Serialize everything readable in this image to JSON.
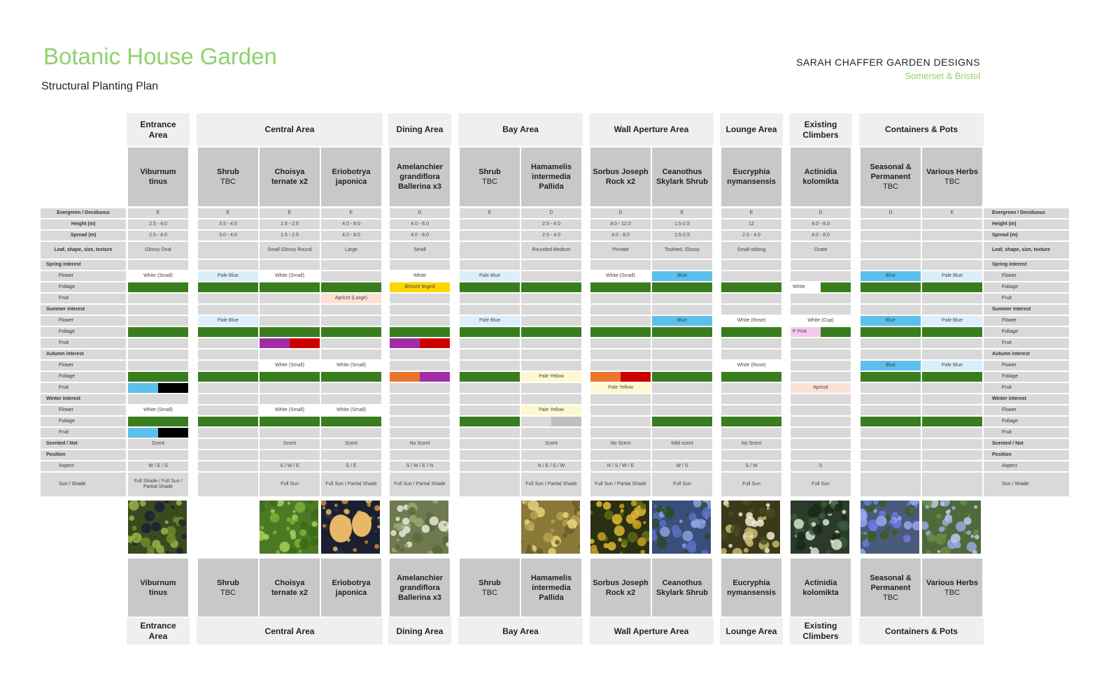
{
  "header": {
    "title": "Botanic House Garden",
    "subtitle": "Structural Planting Plan",
    "brand": "SARAH CHAFFER GARDEN DESIGNS",
    "brand_sub": "Somerset & Bristol"
  },
  "areas": [
    {
      "name": "Entrance Area",
      "name_html": "Entrance<br>Area",
      "cols": [
        0
      ]
    },
    {
      "name": "Central Area",
      "cols": [
        1,
        2,
        3
      ]
    },
    {
      "name": "Dining Area",
      "cols": [
        4
      ]
    },
    {
      "name": "Bay Area",
      "cols": [
        5,
        6
      ]
    },
    {
      "name": "Wall Aperture Area",
      "cols": [
        7,
        8
      ]
    },
    {
      "name": "Lounge Area",
      "cols": [
        9
      ]
    },
    {
      "name": "Existing Climbers",
      "name_html": "Existing<br>Climbers",
      "cols": [
        10
      ]
    },
    {
      "name": "Containers & Pots",
      "cols": [
        11,
        12
      ]
    }
  ],
  "plants": [
    {
      "lines": [
        "Viburnum",
        "tinus"
      ],
      "bold": [
        true,
        true
      ]
    },
    {
      "lines": [
        "Shrub",
        "TBC"
      ],
      "bold": [
        true,
        false
      ]
    },
    {
      "lines": [
        "Choisya",
        "ternate x2"
      ],
      "bold": [
        true,
        true
      ]
    },
    {
      "lines": [
        "Eriobotrya",
        "japonica"
      ],
      "bold": [
        true,
        true
      ]
    },
    {
      "lines": [
        "Amelanchier",
        "grandiflora",
        "Ballerina x3"
      ],
      "bold": [
        true,
        true,
        true
      ]
    },
    {
      "lines": [
        "Shrub",
        "TBC"
      ],
      "bold": [
        true,
        false
      ]
    },
    {
      "lines": [
        "Hamamelis",
        "intermedia",
        "Pallida"
      ],
      "bold": [
        true,
        true,
        true
      ]
    },
    {
      "lines": [
        "Sorbus Joseph",
        "Rock x2"
      ],
      "bold": [
        true,
        true
      ]
    },
    {
      "lines": [
        "Ceanothus",
        "Skylark Shrub"
      ],
      "bold": [
        true,
        true
      ]
    },
    {
      "lines": [
        "Eucryphia",
        "nymansensis"
      ],
      "bold": [
        true,
        true
      ]
    },
    {
      "lines": [
        "Actinidia",
        "kolomikta"
      ],
      "bold": [
        true,
        true
      ]
    },
    {
      "lines": [
        "Seasonal &",
        "Permanent",
        "TBC"
      ],
      "bold": [
        true,
        true,
        false
      ]
    },
    {
      "lines": [
        "Various Herbs",
        "TBC"
      ],
      "bold": [
        true,
        false
      ]
    }
  ],
  "row_labels_left": [
    "Evergreen / Deciduous",
    "Height (m)",
    "Spread (m)",
    "Leaf, shape, size, texture",
    "Spring interest",
    "Flower",
    "Foliage",
    "Fruit",
    "Summer interest",
    "Flower",
    "Foliage",
    "Fruit",
    "Autumn interest",
    "Flower",
    "Foliage",
    "Fruit",
    "Winter interest",
    "Flower",
    "Foliage",
    "Fruit",
    "Scented / Not",
    "Position",
    "Aspect",
    "Sun / Shade"
  ],
  "row_labels_right": [
    "Evergreen / Deciduous",
    "Height (m)",
    "Spread (m)",
    "Leaf, shape, size, texture",
    "Spring interest",
    "Flower",
    "Foliage",
    "Fruit",
    "Summer interest",
    "Flower",
    "Foliage",
    "Fruit",
    "Autumn interest",
    "Flower",
    "Foliage",
    "Fruit",
    "Winter interest",
    "Flower",
    "Foliage",
    "Fruit",
    "Scented / Not",
    "Position",
    "Aspect",
    "Sun / Shade"
  ],
  "row_headers": [
    0,
    0,
    0,
    0,
    1,
    0,
    0,
    0,
    1,
    0,
    0,
    0,
    1,
    0,
    0,
    0,
    1,
    0,
    0,
    0,
    0,
    1,
    0,
    0
  ],
  "colors": {
    "green": "#3a7d1f",
    "pale_blue": "#dbeefa",
    "blue": "#5bc0eb",
    "yellow": "#ffd500",
    "purple": "#a12da6",
    "red": "#cc0000",
    "orange": "#e8762c",
    "black": "#000000",
    "pale_yellow": "#fdf8d0",
    "peach": "#fde0d4",
    "pink": "#f7c8f0",
    "white": "#ffffff",
    "mid_grey": "#bfbfbf"
  },
  "grid": [
    [
      {
        "t": "E"
      },
      {
        "t": "2.5 - 4.0"
      },
      {
        "t": "2.5 - 4.0"
      },
      {
        "t": "Glossy Oval"
      },
      null,
      {
        "t": "White (Small)",
        "c": "white"
      },
      {
        "c": "green"
      },
      null,
      null,
      null,
      {
        "c": "green"
      },
      null,
      null,
      null,
      {
        "c": "green"
      },
      {
        "split": [
          "blue",
          "black"
        ]
      },
      null,
      {
        "t": "White (Small)",
        "c": "white"
      },
      {
        "c": "green"
      },
      {
        "split": [
          "blue",
          "black"
        ]
      },
      {
        "t": "Scent"
      },
      null,
      {
        "t": "W / E / S"
      },
      {
        "t": "Full Shade / Full Sun / Partial Shade"
      }
    ],
    [
      {
        "t": "E"
      },
      {
        "t": "3.5 - 4.5"
      },
      {
        "t": "3.0 - 4.0"
      },
      null,
      null,
      {
        "t": "Pale Blue",
        "c": "pale_blue"
      },
      {
        "c": "green"
      },
      null,
      null,
      {
        "t": "Pale Blue",
        "c": "pale_blue"
      },
      {
        "c": "green"
      },
      null,
      null,
      null,
      {
        "c": "green"
      },
      null,
      null,
      null,
      {
        "c": "green"
      },
      null,
      null,
      null,
      null,
      null
    ],
    [
      {
        "t": "E"
      },
      {
        "t": "1.5 - 2.5"
      },
      {
        "t": "1.5 - 2.5"
      },
      {
        "t": "Small Glossy Round"
      },
      null,
      {
        "t": "White (Small)",
        "c": "white"
      },
      {
        "c": "green"
      },
      null,
      null,
      null,
      {
        "c": "green"
      },
      {
        "split": [
          "purple",
          "red"
        ]
      },
      null,
      {
        "t": "White (Small)",
        "c": "white"
      },
      {
        "c": "green"
      },
      null,
      null,
      {
        "t": "White (Small)",
        "c": "white"
      },
      {
        "c": "green"
      },
      null,
      {
        "t": "Scent"
      },
      null,
      {
        "t": "S / W / E"
      },
      {
        "t": "Full Sun"
      }
    ],
    [
      {
        "t": "E"
      },
      {
        "t": "4.0 - 8.0"
      },
      {
        "t": "4.0 - 8.0"
      },
      {
        "t": "Large"
      },
      null,
      null,
      {
        "c": "green"
      },
      {
        "t": "Apricot (Large)",
        "c": "peach"
      },
      null,
      null,
      {
        "c": "green"
      },
      null,
      null,
      {
        "t": "White (Small)",
        "c": "white"
      },
      {
        "c": "green"
      },
      null,
      null,
      {
        "t": "White (Small)",
        "c": "white"
      },
      {
        "c": "green"
      },
      null,
      {
        "t": "Scent"
      },
      null,
      {
        "t": "S / E"
      },
      {
        "t": "Full Sun / Partial Shade"
      }
    ],
    [
      {
        "t": "D"
      },
      {
        "t": "4.0 - 8.0"
      },
      {
        "t": "4.0 - 8.0"
      },
      {
        "t": "Small"
      },
      null,
      {
        "t": "White",
        "c": "white"
      },
      {
        "t": "Bronze tinged",
        "c": "yellow"
      },
      null,
      null,
      null,
      {
        "c": "green"
      },
      {
        "split": [
          "purple",
          "red"
        ]
      },
      null,
      null,
      {
        "split": [
          "orange",
          "purple"
        ]
      },
      null,
      null,
      null,
      null,
      null,
      {
        "t": "No Scent"
      },
      null,
      {
        "t": "S / W / E / N"
      },
      {
        "t": "Full Sun / Partial Shade"
      }
    ],
    [
      {
        "t": "E"
      },
      null,
      null,
      null,
      null,
      {
        "t": "Pale Blue",
        "c": "pale_blue"
      },
      {
        "c": "green"
      },
      null,
      null,
      {
        "t": "Pale Blue",
        "c": "pale_blue"
      },
      {
        "c": "green"
      },
      null,
      null,
      null,
      {
        "c": "green"
      },
      null,
      null,
      null,
      {
        "c": "green"
      },
      null,
      null,
      null,
      null,
      null
    ],
    [
      {
        "t": "D"
      },
      {
        "t": "2.5 - 4.0"
      },
      {
        "t": "2.5 - 4.0"
      },
      {
        "t": "Rounded Medium"
      },
      null,
      null,
      {
        "c": "green"
      },
      null,
      null,
      null,
      {
        "c": "green"
      },
      null,
      null,
      null,
      {
        "t": "Pale Yellow",
        "c": "pale_yellow"
      },
      null,
      null,
      {
        "t": "Pale Yellow",
        "c": "pale_yellow"
      },
      {
        "split": [
          "none",
          "mid_grey"
        ]
      },
      null,
      {
        "t": "Scent"
      },
      null,
      {
        "t": "N / E / S / W"
      },
      {
        "t": "Full Sun / Partial Shade"
      }
    ],
    [
      {
        "t": "D"
      },
      {
        "t": "8.0 - 12.0"
      },
      {
        "t": "4.0 - 8.0"
      },
      {
        "t": "Pinnate"
      },
      null,
      {
        "t": "White (Small)",
        "c": "white"
      },
      {
        "c": "green"
      },
      null,
      null,
      null,
      {
        "c": "green"
      },
      null,
      null,
      null,
      {
        "split": [
          "orange",
          "red"
        ]
      },
      {
        "t": "Pale Yellow",
        "c": "pale_yellow"
      },
      null,
      null,
      null,
      null,
      {
        "t": "No Scent"
      },
      null,
      {
        "t": "N / S / W / E"
      },
      {
        "t": "Full Sun / Partial Shade"
      }
    ],
    [
      {
        "t": "E"
      },
      {
        "t": "1.5-2.5"
      },
      {
        "t": "1.5-2.5"
      },
      {
        "t": "Toothed, Glossy"
      },
      null,
      {
        "t": "Blue",
        "c": "blue"
      },
      {
        "c": "green"
      },
      null,
      null,
      {
        "t": "Blue",
        "c": "blue"
      },
      {
        "c": "green"
      },
      null,
      null,
      null,
      {
        "c": "green"
      },
      null,
      null,
      null,
      {
        "c": "green"
      },
      null,
      {
        "t": "Mild scent"
      },
      null,
      {
        "t": "W / S"
      },
      {
        "t": "Full Sun"
      }
    ],
    [
      {
        "t": "E"
      },
      {
        "t": "12"
      },
      {
        "t": "2.5 - 4.0"
      },
      {
        "t": "Small oblong"
      },
      null,
      null,
      {
        "c": "green"
      },
      null,
      null,
      {
        "t": "White (Rose)",
        "c": "white"
      },
      {
        "c": "green"
      },
      null,
      null,
      {
        "t": "White (Rose)",
        "c": "white"
      },
      {
        "c": "green"
      },
      null,
      null,
      null,
      {
        "c": "green"
      },
      null,
      {
        "t": "No Scent"
      },
      null,
      {
        "t": "S / W"
      },
      {
        "t": "Full Sun"
      }
    ],
    [
      {
        "t": "D"
      },
      {
        "t": "4.0 - 8.0"
      },
      {
        "t": "4.0 - 8.0"
      },
      {
        "t": "Ovate"
      },
      null,
      null,
      {
        "split2": [
          {
            "t": "White",
            "c": "white"
          },
          {
            "c": "green"
          }
        ]
      },
      null,
      null,
      {
        "t": "White (Cup)",
        "c": "white"
      },
      {
        "split2": [
          {
            "t": "P Pink",
            "c": "pink"
          },
          {
            "c": "green"
          }
        ]
      },
      null,
      null,
      null,
      null,
      {
        "t": "Apricot",
        "c": "peach"
      },
      null,
      null,
      null,
      null,
      null,
      null,
      {
        "t": "S"
      },
      {
        "t": "Full Sun"
      }
    ],
    [
      {
        "t": "D"
      },
      null,
      null,
      null,
      null,
      {
        "t": "Blue",
        "c": "blue"
      },
      {
        "c": "green"
      },
      null,
      null,
      {
        "t": "Blue",
        "c": "blue"
      },
      {
        "c": "green"
      },
      null,
      null,
      {
        "t": "Blue",
        "c": "blue"
      },
      {
        "c": "green"
      },
      null,
      null,
      null,
      {
        "c": "green"
      },
      null,
      null,
      null,
      null,
      null
    ],
    [
      {
        "t": "E"
      },
      null,
      null,
      null,
      null,
      {
        "t": "Pale Blue",
        "c": "pale_blue"
      },
      {
        "c": "green"
      },
      null,
      null,
      {
        "t": "Pale Blue",
        "c": "pale_blue"
      },
      {
        "c": "green"
      },
      null,
      null,
      {
        "t": "Pale Blue",
        "c": "pale_blue"
      },
      {
        "c": "green"
      },
      null,
      null,
      null,
      {
        "c": "green"
      },
      null,
      null,
      null,
      null,
      null
    ]
  ],
  "photos": [
    {
      "col": 0,
      "kind": "viburnum-photo",
      "bg": "#3a4a1e"
    },
    {
      "col": 2,
      "kind": "choisya-photo",
      "bg": "#4b7a24"
    },
    {
      "col": 3,
      "kind": "loquat-photo",
      "bg": "#1a2030"
    },
    {
      "col": 4,
      "kind": "amelanchier-photo",
      "bg": "#6f7a52"
    },
    {
      "col": 6,
      "kind": "hamamelis-photo",
      "bg": "#8a7a3a"
    },
    {
      "col": 7,
      "kind": "sorbus-photo",
      "bg": "#2a3012"
    },
    {
      "col": 8,
      "kind": "ceanothus-photo",
      "bg": "#3a4e7a"
    },
    {
      "col": 9,
      "kind": "eucryphia-photo",
      "bg": "#3a3a1a"
    },
    {
      "col": 10,
      "kind": "actinidia-photo",
      "bg": "#2b3a2a"
    },
    {
      "col": 11,
      "kind": "agapanthus-photo",
      "bg": "#4a5a7a"
    },
    {
      "col": 12,
      "kind": "rosemary-photo",
      "bg": "#4f6a3a"
    }
  ]
}
